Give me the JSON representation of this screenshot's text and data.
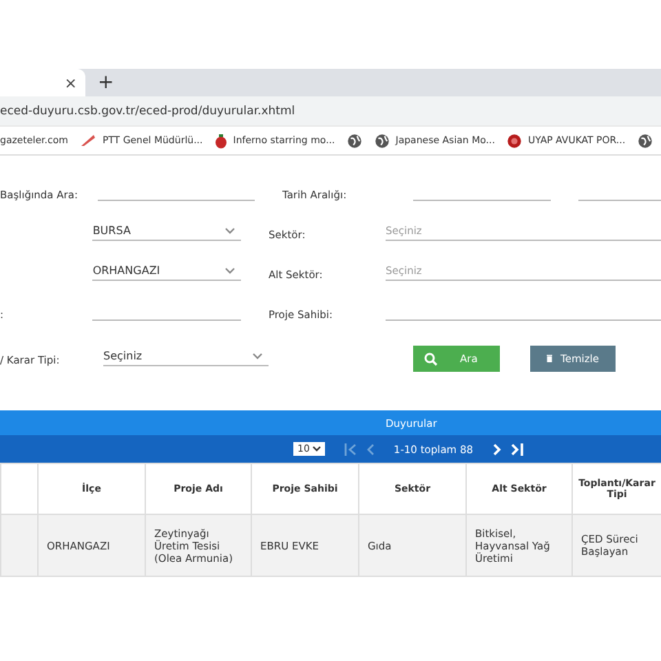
{
  "browser": {
    "tab_close": "×",
    "new_tab": "+",
    "url": "eced-duyuru.csb.gov.tr/eced-prod/duyurular.xhtml",
    "bookmarks": [
      {
        "kind": "plain",
        "label": "gazeteler.com"
      },
      {
        "kind": "pen",
        "label": "PTT Genel Müdürlü..."
      },
      {
        "kind": "berry",
        "label": "Inferno starring mo..."
      },
      {
        "kind": "globe"
      },
      {
        "kind": "globe",
        "label": "Japanese Asian Mo..."
      },
      {
        "kind": "seal",
        "label": "UYAP AVUKAT POR..."
      },
      {
        "kind": "globe"
      }
    ]
  },
  "form": {
    "rows": [
      {
        "label": "Başlığında Ara:",
        "field": {
          "kind": "text"
        },
        "label2": "Tarih Aralığı:",
        "field2": {
          "kind": "date"
        }
      },
      {
        "label": "",
        "field": {
          "kind": "select",
          "value": "BURSA"
        },
        "label2": "Sektör:",
        "field2": {
          "kind": "text",
          "placeholder": "Seçiniz"
        }
      },
      {
        "label": "",
        "field": {
          "kind": "select",
          "value": "ORHANGAZI"
        },
        "label2": "Alt Sektör:",
        "field2": {
          "kind": "text",
          "placeholder": "Seçiniz"
        }
      },
      {
        "label": ":",
        "field": {
          "kind": "text"
        },
        "label2": "Proje Sahibi:",
        "field2": {
          "kind": "text"
        }
      },
      {
        "label": "/ Karar Tipi:",
        "field": {
          "kind": "select",
          "value": "Seçiniz"
        },
        "label2": "",
        "field2": {
          "kind": "buttons"
        }
      }
    ],
    "search_button": "Ara",
    "clear_button": "Temizle"
  },
  "panel": {
    "title": "Duyurular",
    "page_size": "10",
    "range": "1-10 toplam 88",
    "columns": [
      "",
      "İlçe",
      "Proje Adı",
      "Proje Sahibi",
      "Sektör",
      "Alt Sektör",
      "Toplantı/Karar Tipi"
    ],
    "rows": [
      [
        "",
        "ORHANGAZI",
        "Zeytinyağı Üretim Tesisi (Olea Armunia)",
        "EBRU EVKE",
        "Gıda",
        "Bitkisel, Hayvansal Yağ Üretimi",
        "ÇED Süreci Başlayan"
      ]
    ]
  }
}
